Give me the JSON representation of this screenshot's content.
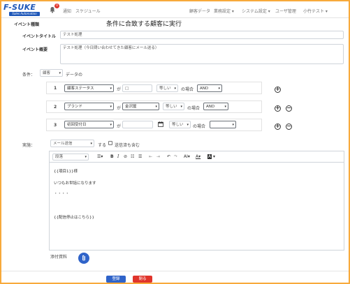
{
  "app": {
    "logo_text": "F-SUKE",
    "logo_sub": "Sales Automation",
    "notification_count": "0",
    "brand_color": "#1e57b8"
  },
  "nav": {
    "left": [
      "通知",
      "スケジュール"
    ],
    "right": [
      "顧客データ",
      "業務設定 ▾",
      "システム設定 ▾",
      "ユーザ管理",
      "小竹テスト ▾"
    ]
  },
  "form": {
    "event_type_label": "イベント種類",
    "event_type_value": "条件に合致する顧客に実行",
    "event_title_label": "イベントタイトル",
    "event_title_value": "テスト処理",
    "event_summary_label": "イベント概要",
    "event_summary_value": "テスト処理（今日問い合わせてきた顧客にメール送る）",
    "condition_label": "条件：",
    "condition_target": "顧客",
    "condition_suffix": "データの"
  },
  "rules": [
    {
      "no": "1",
      "field": "顧客ステータス",
      "ga": "が",
      "value": "□",
      "op": "等しい",
      "case": "の場合",
      "join": "AND",
      "has_remove": false
    },
    {
      "no": "2",
      "field": "ブランド",
      "ga": "が",
      "value": "金沢屋",
      "op": "等しい",
      "case": "の場合",
      "join": "AND",
      "has_remove": true
    },
    {
      "no": "3",
      "field": "初回受付日",
      "ga": "が",
      "value": "",
      "op": "等しい",
      "case": "の場合",
      "join": "",
      "has_remove": true
    }
  ],
  "action": {
    "label": "実施：",
    "type": "メール送信",
    "suru": "する",
    "include_sender": "送信済も含む"
  },
  "editor": {
    "paragraph": "段落",
    "lines": [
      "{{項目1}}様",
      "いつもお世話になります",
      "・・・・",
      "{{配信停止はこちら}}"
    ]
  },
  "attachment_label": "添付資料",
  "buttons": {
    "register": "登録",
    "close": "閉る",
    "register_color": "#2f63c9",
    "close_color": "#e0342b"
  }
}
